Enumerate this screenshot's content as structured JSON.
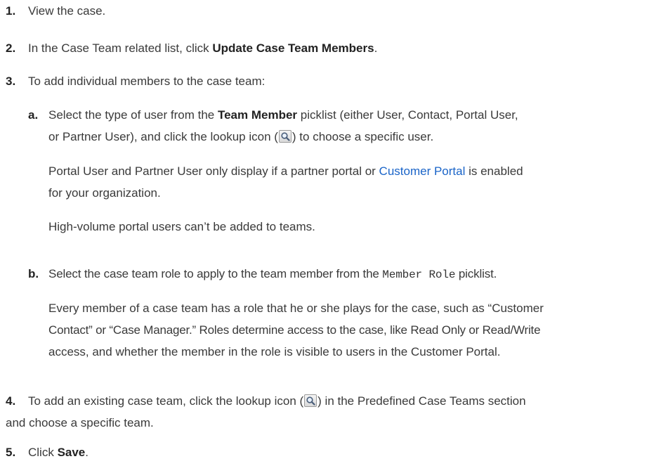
{
  "steps": {
    "s1": {
      "num": "1.",
      "text": "View the case."
    },
    "s2": {
      "num": "2.",
      "pre": "In the Case Team related list, click ",
      "bold": "Update Case Team Members",
      "post": "."
    },
    "s3": {
      "num": "3.",
      "text": "To add individual members to the case team:",
      "a": {
        "letter": "a.",
        "pre": "Select the type of user from the ",
        "bold": "Team Member",
        "mid": " picklist (either User, Contact, Portal User,",
        "line2_pre": "or Partner User), and click the lookup icon (",
        "line2_post": ") to choose a specific user.",
        "note1_line1_pre": "Portal User and Partner User only display if a partner portal or ",
        "note1_link": "Customer Portal",
        "note1_line1_post": " is enabled",
        "note1_line2": "for your organization.",
        "note2": "High-volume portal users can’t be added to teams."
      },
      "b": {
        "letter": "b.",
        "pre": "Select the case team role to apply to the team member from the ",
        "code": "Member Role",
        "post": " picklist.",
        "p_line1": "Every member of a case team has a role that he or she plays for the case, such as “Customer",
        "p_line2": "Contact” or “Case Manager.” Roles determine access to the case, like Read Only or Read/Write",
        "p_line3": "access, and whether the member in the role is visible to users in the Customer Portal."
      }
    },
    "s4": {
      "num": "4.",
      "line1_pre": "To add an existing case team, click the lookup icon (",
      "line1_post": ") in the Predefined Case Teams section",
      "line2": "and choose a specific team."
    },
    "s5": {
      "num": "5.",
      "pre": "Click ",
      "bold": "Save",
      "post": "."
    }
  },
  "icons": {
    "lookup": "magnifier-lookup-icon"
  }
}
